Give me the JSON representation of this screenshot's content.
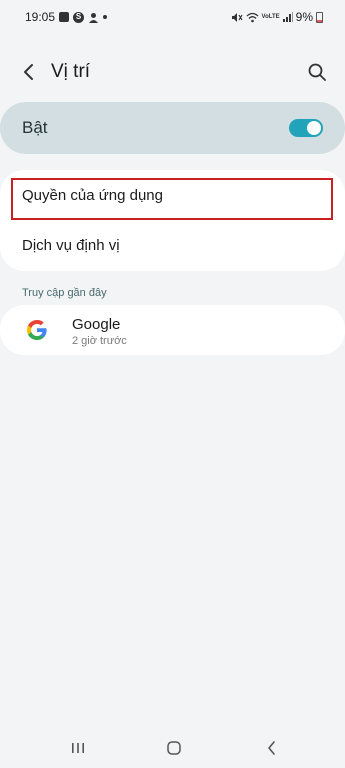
{
  "status_bar": {
    "time": "19:05",
    "battery": "9%",
    "network": "VoLTE"
  },
  "header": {
    "title": "Vị trí",
    "back_icon": "chevron-left-icon",
    "search_icon": "search-icon"
  },
  "location_toggle": {
    "label": "Bật",
    "state": "on",
    "accent_color": "#21a4b9"
  },
  "settings_items": [
    {
      "label": "Quyền của ứng dụng"
    },
    {
      "label": "Dịch vụ định vị"
    }
  ],
  "recent_access": {
    "header": "Truy cập gần đây",
    "items": [
      {
        "name": "Google",
        "time": "2 giờ trước",
        "icon": "google-icon"
      }
    ]
  },
  "highlight_color": "#cc1f1f",
  "nav_bar": {
    "recents_icon": "recents-icon",
    "home_icon": "home-icon",
    "back_icon": "back-icon"
  }
}
